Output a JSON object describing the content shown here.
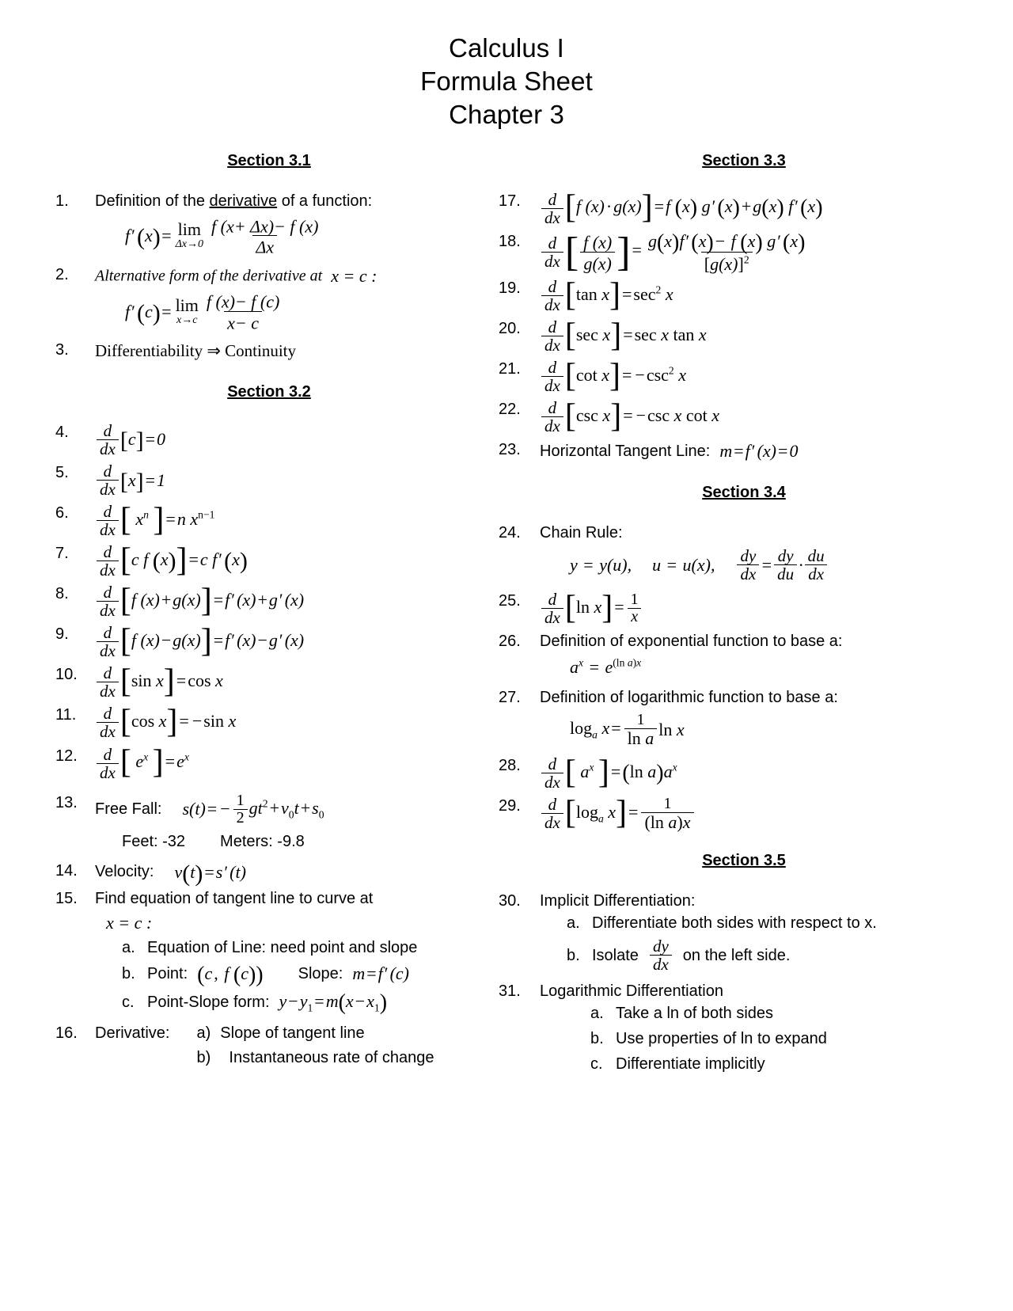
{
  "title": {
    "line1": "Calculus I",
    "line2": "Formula Sheet",
    "line3": "Chapter 3"
  },
  "sections": {
    "s31": "Section 3.1",
    "s32": "Section 3.2",
    "s33": "Section 3.3",
    "s34": "Section 3.4",
    "s35": "Section 3.5"
  },
  "numbers": {
    "n1": "1.",
    "n2": "2.",
    "n3": "3.",
    "n4": "4.",
    "n5": "5.",
    "n6": "6.",
    "n7": "7.",
    "n8": "8.",
    "n9": "9.",
    "n10": "10.",
    "n11": "11.",
    "n12": "12.",
    "n13": "13.",
    "n14": "14.",
    "n15": "15.",
    "n16": "16.",
    "n17": "17.",
    "n18": "18.",
    "n19": "19.",
    "n20": "20.",
    "n21": "21.",
    "n22": "22.",
    "n23": "23.",
    "n24": "24.",
    "n25": "25.",
    "n26": "26.",
    "n27": "27.",
    "n28": "28.",
    "n29": "29.",
    "n30": "30.",
    "n31": "31.",
    "la": "a.",
    "lb": "b.",
    "lc": "c.",
    "pa": "a)",
    "pb": "b)"
  },
  "items": {
    "i1": {
      "text_before": "Definition of the ",
      "text_underline": "derivative",
      "text_after": " of a function:",
      "formula": "f'(x) = lim (Δx→0) [ f(x+Δx) − f(x) ] / Δx"
    },
    "i2": {
      "text": "Alternative form of the derivative at",
      "condition": "x = c :",
      "formula": "f'(c) = lim (x→c) [ f(x) − f(c) ] / (x − c)"
    },
    "i3": {
      "text": "Differentiability ⇒ Continuity"
    },
    "i4": {
      "formula": "d/dx [c] = 0"
    },
    "i5": {
      "formula": "d/dx [x] = 1"
    },
    "i6": {
      "formula": "d/dx [x^n] = n x^(n−1)"
    },
    "i7": {
      "formula": "d/dx [c f(x)] = c f'(x)"
    },
    "i8": {
      "formula": "d/dx [f(x) + g(x)] = f'(x) + g'(x)"
    },
    "i9": {
      "formula": "d/dx [f(x) − g(x)] = f'(x) − g'(x)"
    },
    "i10": {
      "formula": "d/dx [sin x] = cos x"
    },
    "i11": {
      "formula": "d/dx [cos x] = − sin x"
    },
    "i12": {
      "formula": "d/dx [e^x] = e^x"
    },
    "i13": {
      "label": "Free Fall:",
      "formula": "s(t) = − (1/2) g t^2 + v_0 t + s_0",
      "feet": "Feet: -32",
      "meters": "Meters:  -9.8"
    },
    "i14": {
      "label": "Velocity:",
      "formula": "v(t) = s'(t)"
    },
    "i15": {
      "text": "Find equation of tangent line to curve at",
      "condition": "x = c :",
      "a": "Equation of Line:  need point and slope",
      "b_label": "Point:",
      "b_point": "(c, f(c))",
      "b_slope_label": "Slope:",
      "b_slope": "m = f'(c)",
      "c_label": "Point-Slope form:",
      "c_formula": "y − y₁ = m( x − x₁ )"
    },
    "i16": {
      "label": "Derivative:",
      "a": "Slope of tangent line",
      "b": "Instantaneous rate of change"
    },
    "i17": {
      "formula": "d/dx [f(x)·g(x)] = f(x) g'(x) + g(x) f'(x)"
    },
    "i18": {
      "formula": "d/dx [ f(x)/g(x) ] = [ g(x) f'(x) − f(x) g'(x) ] / [g(x)]^2"
    },
    "i19": {
      "formula": "d/dx [tan x] = sec^2 x"
    },
    "i20": {
      "formula": "d/dx [sec x] = sec x tan x"
    },
    "i21": {
      "formula": "d/dx [cot x] = − csc^2 x"
    },
    "i22": {
      "formula": "d/dx [csc x] = − csc x cot x"
    },
    "i23": {
      "label": "Horizontal Tangent Line:",
      "formula": "m = f'(x) = 0"
    },
    "i24": {
      "label": "Chain Rule:",
      "formula": "y = y(u),   u = u(x),   dy/dx = dy/du · du/dx"
    },
    "i25": {
      "formula": "d/dx [ln x] = 1/x"
    },
    "i26": {
      "label": "Definition of exponential function to base a:",
      "formula": "a^x = e^((ln a)x)"
    },
    "i27": {
      "label": "Definition of logarithmic function to base a:",
      "formula": "log_a x = (1 / ln a) ln x"
    },
    "i28": {
      "formula": "d/dx [a^x] = (ln a) a^x"
    },
    "i29": {
      "formula": "d/dx [log_a x] = 1 / ((ln a) x)"
    },
    "i30": {
      "label": "Implicit Differentiation:",
      "a": "Differentiate both sides with respect to x.",
      "b_before": "Isolate",
      "b_frac": "dy/dx",
      "b_after": "on the left side."
    },
    "i31": {
      "label": "Logarithmic Differentiation",
      "a": "Take a ln of both sides",
      "b": "Use properties of ln to expand",
      "c": "Differentiate implicitly"
    }
  },
  "glyphs": {
    "d": "d",
    "dx": "dx",
    "du": "du",
    "dy": "dy",
    "eq": "=",
    "plus": "+",
    "minus": "−",
    "cdot": "·",
    "lbr": "[",
    "rbr": "]",
    "lpar": "(",
    "rpar": ")",
    "implies": "⇒",
    "one": "1",
    "two": "2",
    "zero": "0"
  }
}
